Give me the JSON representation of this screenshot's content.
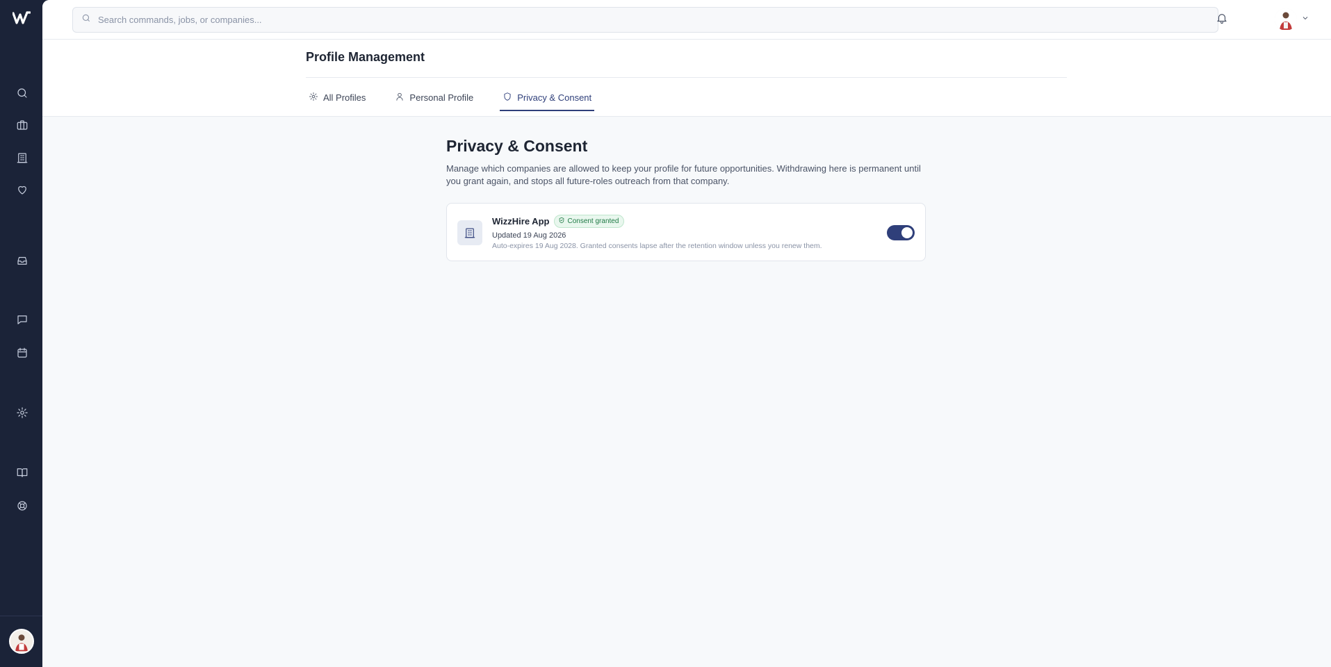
{
  "app": {
    "logo_icon": "wizzhire-logo-icon"
  },
  "sidebar": {
    "items": [
      {
        "name": "search",
        "icon": "search-icon"
      },
      {
        "name": "jobs",
        "icon": "briefcase-icon"
      },
      {
        "name": "companies",
        "icon": "building-icon"
      },
      {
        "name": "saved",
        "icon": "heart-icon"
      },
      {
        "name": "inbox",
        "icon": "inbox-icon"
      },
      {
        "name": "messages",
        "icon": "message-icon"
      },
      {
        "name": "calendar",
        "icon": "calendar-icon"
      },
      {
        "name": "settings",
        "icon": "gear-icon"
      },
      {
        "name": "guide",
        "icon": "book-icon"
      },
      {
        "name": "help",
        "icon": "lifebuoy-icon"
      }
    ]
  },
  "topbar": {
    "search_placeholder": "Search commands, jobs, or companies..."
  },
  "header": {
    "title": "Profile Management",
    "tabs": [
      {
        "label": "All Profiles",
        "icon": "gear-icon",
        "active": false
      },
      {
        "label": "Personal Profile",
        "icon": "user-icon",
        "active": false
      },
      {
        "label": "Privacy & Consent",
        "icon": "shield-icon",
        "active": true
      }
    ]
  },
  "content": {
    "title": "Privacy & Consent",
    "description": "Manage which companies are allowed to keep your profile for future opportunities. Withdrawing here is permanent until you grant again, and stops all future-roles outreach from that company.",
    "consents": [
      {
        "company": "WizzHire App",
        "badge": "Consent granted",
        "updated": "Updated 19 Aug 2026",
        "expiry": "Auto-expires 19 Aug 2028. Granted consents lapse after the retention window unless you renew them.",
        "granted": true
      }
    ]
  },
  "colors": {
    "sidebar_bg": "#1b2338",
    "accent": "#2f3f7a",
    "success": "#1f7a45",
    "page_bg": "#f7f9fb"
  }
}
